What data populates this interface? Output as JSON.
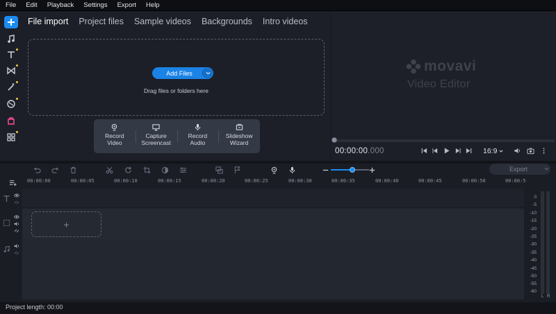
{
  "menu": [
    "File",
    "Edit",
    "Playback",
    "Settings",
    "Export",
    "Help"
  ],
  "left_tools": [
    {
      "icon": "plus-icon",
      "name": "import"
    },
    {
      "icon": "music-note-icon",
      "name": "music"
    },
    {
      "icon": "title-text-icon",
      "name": "titles"
    },
    {
      "icon": "transitions-icon",
      "name": "transitions"
    },
    {
      "icon": "magic-wand-icon",
      "name": "filters"
    },
    {
      "icon": "stickers-icon",
      "name": "stickers"
    },
    {
      "icon": "more-tools-icon",
      "name": "more-tools"
    },
    {
      "icon": "grid-icon",
      "name": "grid"
    }
  ],
  "import": {
    "tabs": [
      "File import",
      "Project files",
      "Sample videos",
      "Backgrounds",
      "Intro videos"
    ],
    "add_files_label": "Add Files",
    "drag_text": "Drag files or folders here",
    "record_buttons": [
      {
        "line1": "Record",
        "line2": "Video"
      },
      {
        "line1": "Capture",
        "line2": "Screencast"
      },
      {
        "line1": "Record",
        "line2": "Audio"
      },
      {
        "line1": "Slideshow",
        "line2": "Wizard"
      }
    ]
  },
  "player": {
    "brand": "movavi",
    "subtitle": "Video Editor",
    "timecode_main": "00:00:00",
    "timecode_ms": ".000",
    "aspect": "16:9",
    "progress": 0
  },
  "timeline": {
    "export_label": "Export",
    "zoom_level": 0.56,
    "ruler_ticks": [
      "00:00:00",
      "00:00:05",
      "00:00:10",
      "00:00:15",
      "00:00:20",
      "00:00:25",
      "00:00:30",
      "00:00:35",
      "00:00:40",
      "00:00:45",
      "00:00:50",
      "00:00:5"
    ],
    "add_clip_symbol": "+"
  },
  "meter": {
    "levels": [
      "0",
      "-5",
      "-10",
      "-15",
      "-20",
      "-25",
      "-30",
      "-35",
      "-40",
      "-45",
      "-50",
      "-55",
      "-60"
    ],
    "left": "L",
    "right": "R"
  },
  "status": {
    "project_length": "Project length: 00:00"
  }
}
